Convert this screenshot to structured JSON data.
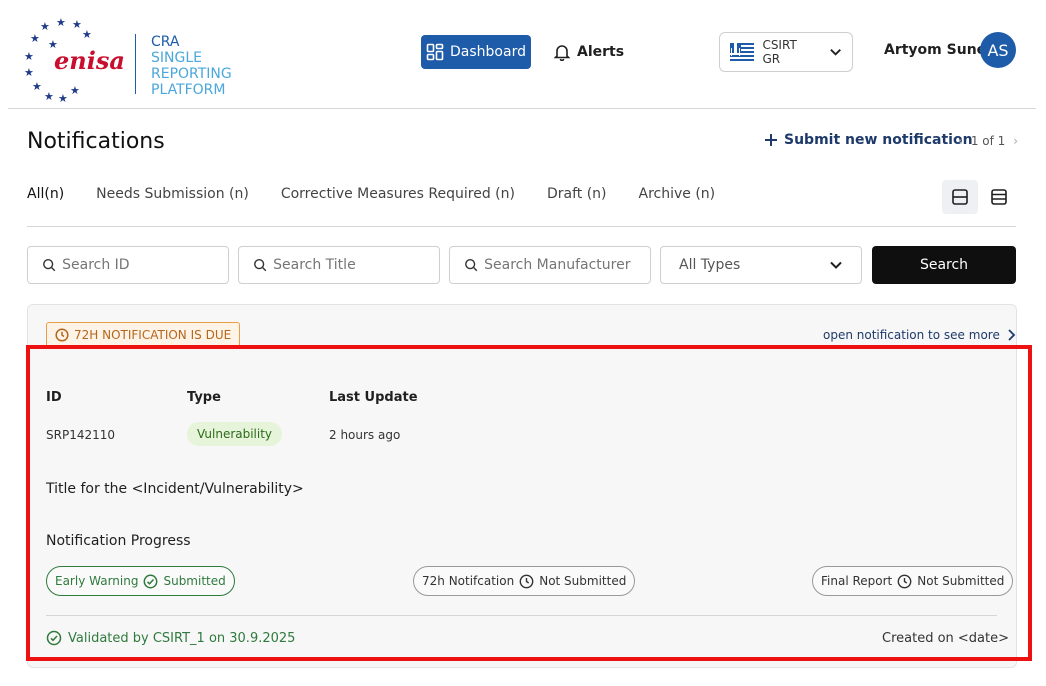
{
  "brand": {
    "logo_text": "enisa",
    "product_line1": "CRA",
    "product_line2": "SINGLE",
    "product_line3": "REPORTING",
    "product_line4": "PLATFORM",
    "color_primary": "#1e5ba8"
  },
  "nav": {
    "dashboard_label": "Dashboard",
    "alerts_label": "Alerts"
  },
  "country_selector": {
    "selected": "CSIRT GR"
  },
  "user": {
    "name": "Artyom Sunek",
    "initials": "AS"
  },
  "page": {
    "title": "Notifications",
    "submit_label": "Submit new notification",
    "pager_text": "1 of 1"
  },
  "tabs": [
    {
      "label": "All(n)",
      "active": true
    },
    {
      "label": "Needs Submission (n)",
      "active": false
    },
    {
      "label": "Corrective Measures Required (n)",
      "active": false
    },
    {
      "label": "Draft (n)",
      "active": false
    },
    {
      "label": "Archive (n)",
      "active": false
    }
  ],
  "filters": {
    "search_id_placeholder": "Search ID",
    "search_title_placeholder": "Search Title",
    "search_manufacturer_placeholder": "Search Manufacturer",
    "type_select_value": "All Types",
    "search_button_label": "Search"
  },
  "notification_card": {
    "due_badge": "72H NOTIFICATION IS DUE",
    "open_more_label": "open notification to see more",
    "columns": {
      "id_header": "ID",
      "type_header": "Type",
      "updated_header": "Last Update"
    },
    "id": "SRP142110",
    "type": "Vulnerability",
    "last_update": "2 hours ago",
    "title": "Title for the <Incident/Vulnerability>",
    "progress_title": "Notification Progress",
    "steps": [
      {
        "name": "Early Warning",
        "status": "Submitted"
      },
      {
        "name": "72h Notifcation",
        "status": "Not Submitted"
      },
      {
        "name": "Final Report",
        "status": "Not Submitted"
      }
    ],
    "validated_text": "Validated by CSIRT_1 on 30.9.2025",
    "created_text": "Created on <date>"
  }
}
